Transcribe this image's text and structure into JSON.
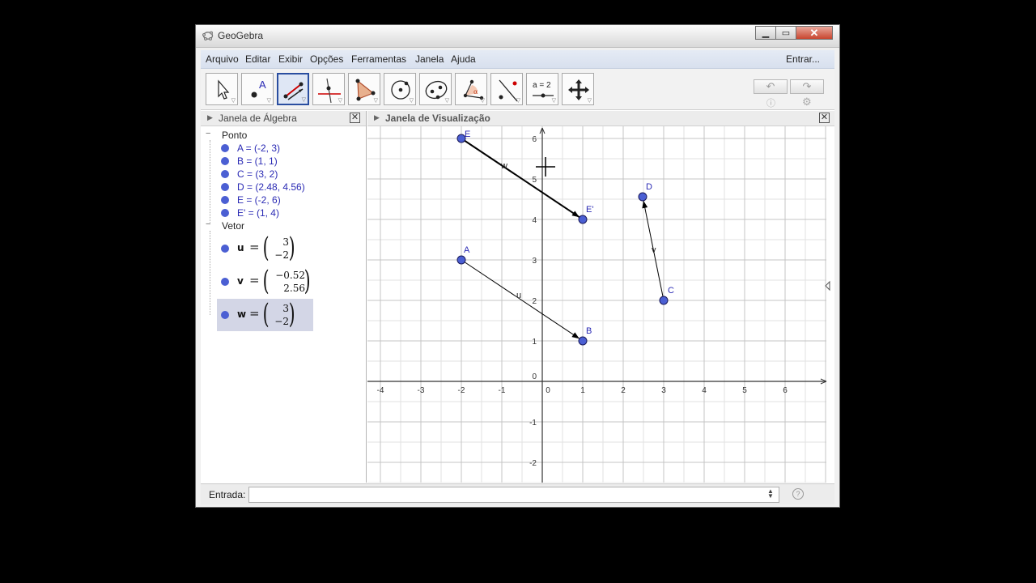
{
  "window": {
    "title": "GeoGebra",
    "icon": "geogebra-icon"
  },
  "menu": {
    "items": [
      "Arquivo",
      "Editar",
      "Exibir",
      "Opções",
      "Ferramentas",
      "Janela",
      "Ajuda"
    ],
    "signin": "Entrar..."
  },
  "toolbar": {
    "tools": [
      "move-tool-icon",
      "point-tool-icon",
      "vector-tool-icon",
      "perpendicular-tool-icon",
      "polygon-tool-icon",
      "circle-tool-icon",
      "conic-tool-icon",
      "angle-tool-icon",
      "reflect-tool-icon",
      "slider-tool-icon",
      "move-view-tool-icon"
    ],
    "active_tool": "vector-tool-icon",
    "slider_label": "a = 2",
    "point_label": "A"
  },
  "algebra": {
    "title": "Janela de Álgebra",
    "groups": [
      {
        "name": "Ponto",
        "items": [
          "A = (-2, 3)",
          "B = (1, 1)",
          "C = (3, 2)",
          "D = (2.48, 4.56)",
          "E = (-2, 6)",
          "E' = (1, 4)"
        ]
      },
      {
        "name": "Vetor",
        "vectors": [
          {
            "name": "u",
            "eq": "=",
            "x": "3",
            "y": "−2",
            "selected": false
          },
          {
            "name": "v",
            "eq": "=",
            "x": "−0.52",
            "y": "2.56",
            "selected": false
          },
          {
            "name": "w",
            "eq": "=",
            "x": "3",
            "y": "−2",
            "selected": true
          }
        ]
      }
    ],
    "point_color": "#4b5fd3"
  },
  "graphics": {
    "title": "Janela de Visualização",
    "x_ticks": [
      "-4",
      "-3",
      "-2",
      "-1",
      "0",
      "1",
      "2",
      "3",
      "4",
      "5",
      "6"
    ],
    "y_ticks": [
      "6",
      "5",
      "4",
      "3",
      "2",
      "1",
      "0",
      "-1",
      "-2"
    ],
    "points": [
      {
        "name": "A",
        "x": -2,
        "y": 3
      },
      {
        "name": "B",
        "x": 1,
        "y": 1
      },
      {
        "name": "C",
        "x": 3,
        "y": 2
      },
      {
        "name": "D",
        "x": 2.48,
        "y": 4.56
      },
      {
        "name": "E",
        "x": -2,
        "y": 6
      },
      {
        "name": "E'",
        "x": 1,
        "y": 4
      }
    ],
    "vectors": [
      {
        "name": "u",
        "from": "A",
        "to": "B"
      },
      {
        "name": "v",
        "from": "C",
        "to": "D"
      },
      {
        "name": "w",
        "from": "E",
        "to": "E'"
      }
    ]
  },
  "input": {
    "label": "Entrada:",
    "value": "",
    "placeholder": ""
  }
}
